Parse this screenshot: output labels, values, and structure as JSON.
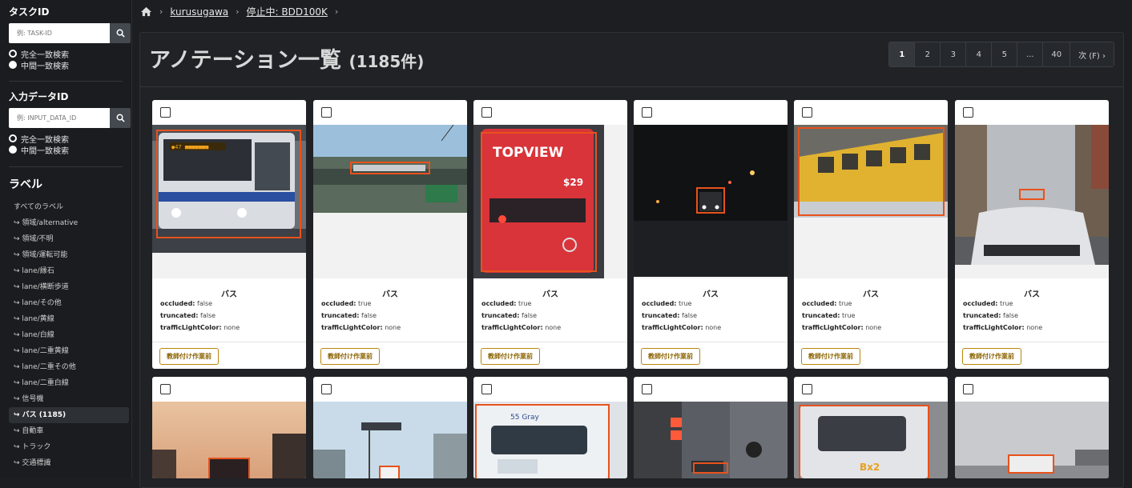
{
  "sidebar": {
    "task_id": {
      "title": "タスクID",
      "placeholder": "例: TASK-ID",
      "options": [
        "完全一致検索",
        "中間一致検索"
      ]
    },
    "input_id": {
      "title": "入力データID",
      "placeholder": "例: INPUT_DATA_ID",
      "options": [
        "完全一致検索",
        "中間一致検索"
      ]
    },
    "labels": {
      "heading": "ラベル",
      "all": "すべてのラベル",
      "items": [
        "↪ 領域/alternative",
        "↪ 領域/不明",
        "↪ 領域/運転可能",
        "↪ lane/縁石",
        "↪ lane/横断歩道",
        "↪ lane/その他",
        "↪ lane/黄線",
        "↪ lane/白線",
        "↪ lane/二重黄線",
        "↪ lane/二重その他",
        "↪ lane/二重白線",
        "↪ 信号機",
        "↪ バス (1185)",
        "↪ 自動車",
        "↪ トラック",
        "↪ 交通標識"
      ]
    }
  },
  "breadcrumb": {
    "user": "kurusugawa",
    "project": "停止中: BDD100K"
  },
  "header": {
    "title": "アノテーション一覧",
    "count": "(1185件)"
  },
  "pagination": [
    "1",
    "2",
    "3",
    "4",
    "5",
    "...",
    "40",
    "次 (F) ›"
  ],
  "cards": [
    {
      "label": "バス",
      "occluded": "false",
      "truncated": "false",
      "color": "none",
      "button": "教師付け作業前"
    },
    {
      "label": "バス",
      "occluded": "true",
      "truncated": "false",
      "color": "none",
      "button": "教師付け作業前"
    },
    {
      "label": "バス",
      "occluded": "true",
      "truncated": "false",
      "color": "none",
      "button": "教師付け作業前"
    },
    {
      "label": "バス",
      "occluded": "true",
      "truncated": "false",
      "color": "none",
      "button": "教師付け作業前"
    },
    {
      "label": "バス",
      "occluded": "true",
      "truncated": "true",
      "color": "none",
      "button": "教師付け作業前"
    },
    {
      "label": "バス",
      "occluded": "true",
      "truncated": "false",
      "color": "none",
      "button": "教師付け作業前"
    }
  ],
  "attr_keys": {
    "occluded": "occluded:",
    "truncated": "truncated:",
    "color": "trafficLightColor:"
  },
  "image_texts": {
    "topview": "TOPVIEW",
    "price": "$29",
    "gray": "55 Gray",
    "bx2": "Bx2"
  },
  "colors": {
    "bbox": "#e8521c",
    "button": "#b8860b"
  }
}
